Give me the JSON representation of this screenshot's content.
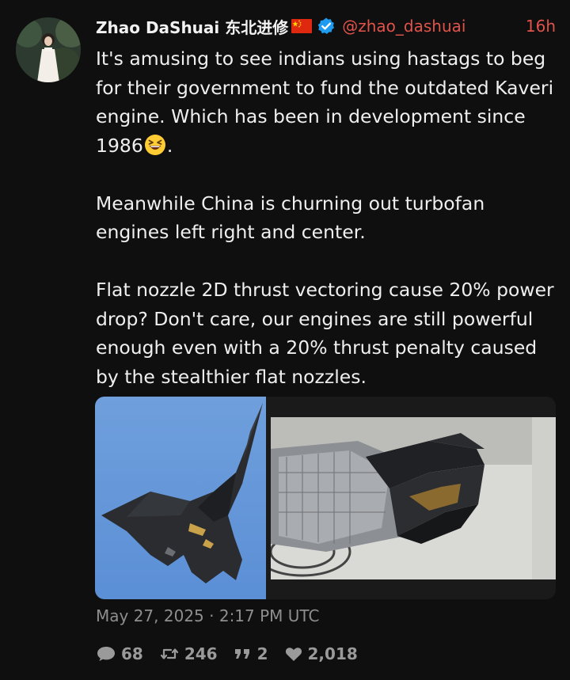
{
  "post": {
    "author_name": "Zhao DaShuai 东北进修",
    "handle": "@zhao_dashuai",
    "time_ago": "16h",
    "paragraphs": [
      "It's amusing to see indians using hastags to beg for their government to fund the outdated Kaveri engine. Which has been in development since 1986",
      "Meanwhile China is churning out turbofan engines left right and center.",
      "Flat nozzle 2D thrust vectoring cause 20% power drop? Don't care, our engines are still powerful enough even with a 20% thrust penalty caused by the stealthier flat nozzles."
    ],
    "paragraph1_end": ".",
    "emoji": "laughing-face",
    "timestamp": "May 27, 2025 · 2:17 PM UTC",
    "stats": {
      "replies": "68",
      "retweets": "246",
      "quotes": "2",
      "likes": "2,018"
    }
  },
  "colors": {
    "background": "#0f0f0f",
    "accent_handle": "#e0534a",
    "verified_badge": "#1d9bf0",
    "muted_text": "#8e8e8e"
  }
}
